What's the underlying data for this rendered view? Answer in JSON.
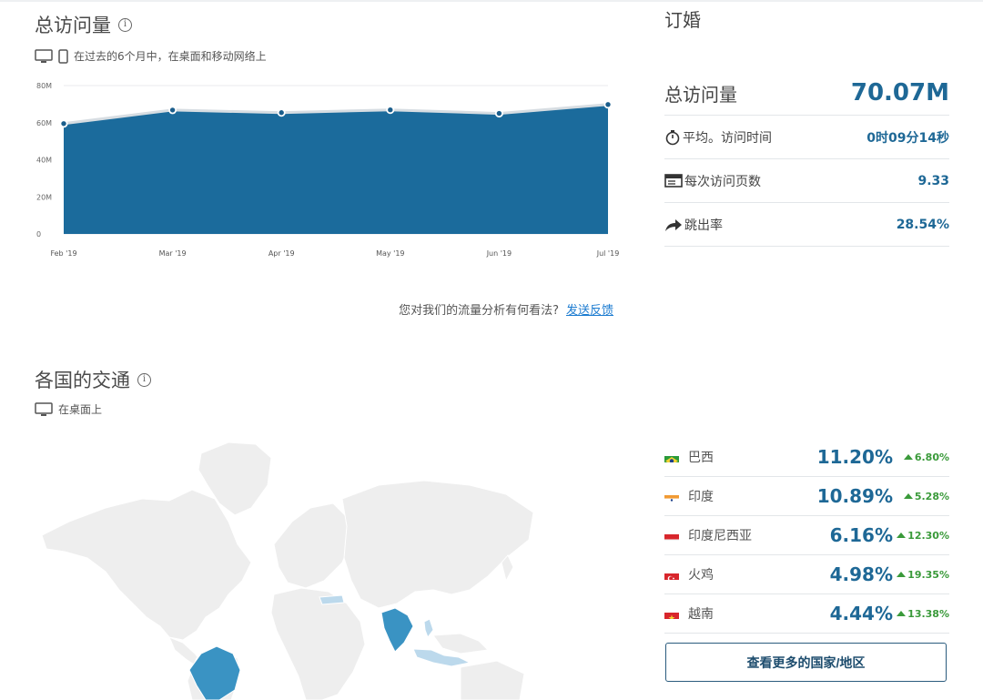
{
  "visits": {
    "title": "总访问量",
    "subtitle": "在过去的6个月中，在桌面和移动网络上",
    "feedback_question": "您对我们的流量分析有何看法?",
    "feedback_link": "发送反馈"
  },
  "chart_data": {
    "type": "area",
    "x": [
      "Feb '19",
      "Mar '19",
      "Apr '19",
      "May '19",
      "Jun '19",
      "Jul '19"
    ],
    "series": [
      {
        "values": [
          59.5,
          66.8,
          65.4,
          66.9,
          65.0,
          69.8
        ]
      }
    ],
    "y_ticks": [
      "0",
      "20M",
      "40M",
      "60M",
      "80M"
    ],
    "ylim": [
      0,
      80
    ],
    "grid": true,
    "color": "#1b6b9c"
  },
  "engagement": {
    "title": "订婚",
    "total_label": "总访问量",
    "total_value": "70.07M",
    "rows": [
      {
        "icon": "stopwatch-icon",
        "label": "平均。访问时间",
        "value": "0时09分14秒"
      },
      {
        "icon": "pages-icon",
        "label": "每次访问页数",
        "value": "9.33"
      },
      {
        "icon": "bounce-arrow-icon",
        "label": "跳出率",
        "value": "28.54%"
      }
    ]
  },
  "geo": {
    "title": "各国的交通",
    "subtitle": "在桌面上",
    "countries": [
      {
        "name": "巴西",
        "share": "11.20%",
        "change": "6.80%",
        "flag": "brazil"
      },
      {
        "name": "印度",
        "share": "10.89%",
        "change": "5.28%",
        "flag": "india"
      },
      {
        "name": "印度尼西亚",
        "share": "6.16%",
        "change": "12.30%",
        "flag": "indonesia"
      },
      {
        "name": "火鸡",
        "share": "4.98%",
        "change": "19.35%",
        "flag": "turkey"
      },
      {
        "name": "越南",
        "share": "4.44%",
        "change": "13.38%",
        "flag": "vietnam"
      }
    ],
    "more_button": "查看更多的国家/地区"
  },
  "colors": {
    "accent": "#1e6896",
    "positive": "#3a9a3a",
    "map_highlight": "#3a93c3",
    "map_light": "#bcd9ec"
  }
}
